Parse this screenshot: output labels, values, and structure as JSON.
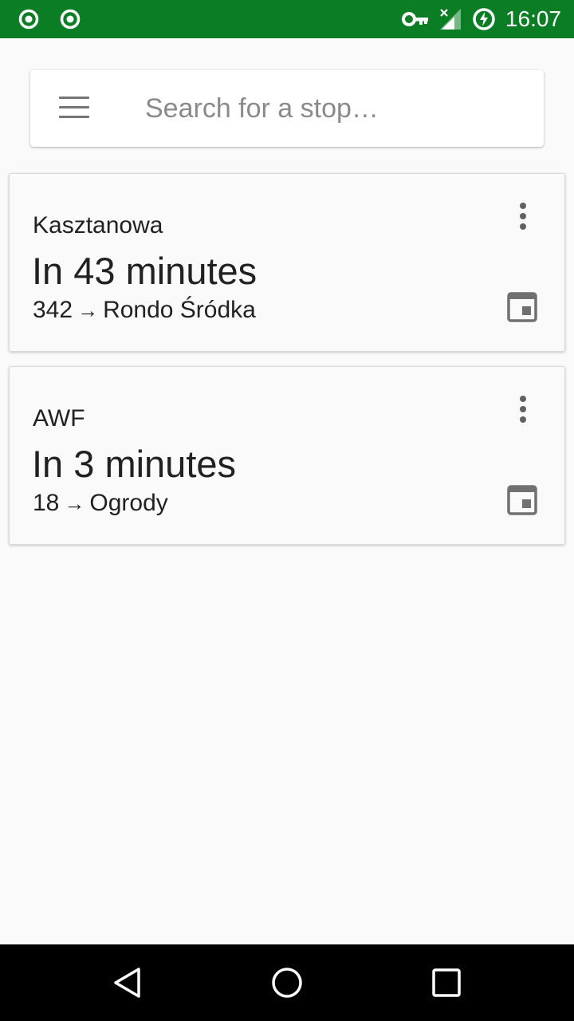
{
  "status_bar": {
    "time": "16:07",
    "left_icons": [
      "target-icon",
      "target-icon"
    ],
    "right_icons": [
      "key-icon",
      "signal-icon",
      "battery-charging-icon"
    ],
    "color": "#0b7d24"
  },
  "search": {
    "placeholder": "Search for a stop…",
    "value": "",
    "menu_icon": "menu-icon"
  },
  "departures": [
    {
      "stop": "Kasztanowa",
      "eta": "In 43 minutes",
      "line": "342",
      "arrow": "→",
      "direction": "Rondo Śródka"
    },
    {
      "stop": "AWF",
      "eta": "In 3 minutes",
      "line": "18",
      "arrow": "→",
      "direction": "Ogrody"
    }
  ],
  "nav_bar": {
    "buttons": [
      "back-icon",
      "home-icon",
      "recents-icon"
    ]
  }
}
